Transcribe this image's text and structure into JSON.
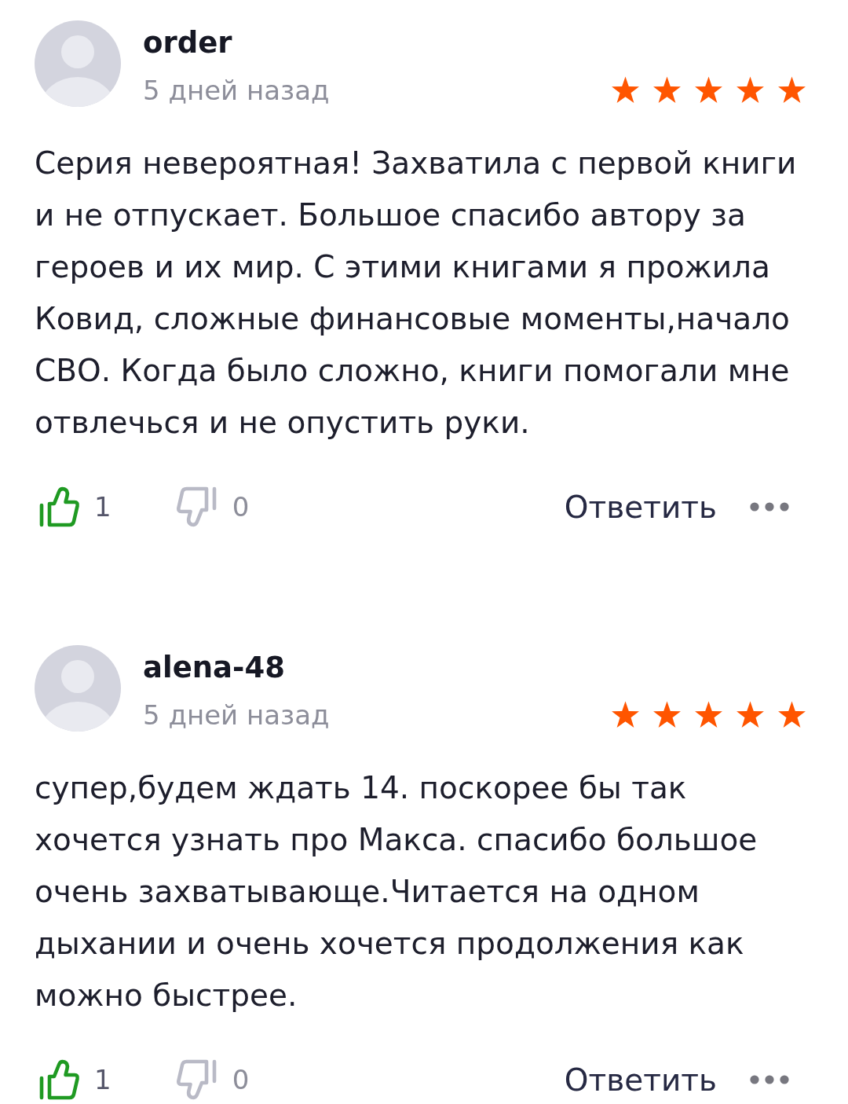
{
  "reviews": [
    {
      "author": "order",
      "date": "5 дней назад",
      "stars": 5,
      "text": "Серия невероятная! Захватила с первой книги и не отпускает. Большое спасибо автору за героев и их мир. С этими книгами я прожила Ковид, сложные финансовые моменты,начало СВО. Когда было сложно, книги помогали мне отвлечься и не опустить руки.",
      "likes": "1",
      "dislikes": "0",
      "reply": "Ответить"
    },
    {
      "author": "alena-48",
      "date": "5 дней назад",
      "stars": 5,
      "text": "супер,будем ждать 14. поскорее бы так хочется узнать про Макса. спасибо большое очень захватывающе.Читается на одном дыхании и очень хочется продолжения как можно быстрее.",
      "likes": "1",
      "dislikes": "0",
      "reply": "Ответить"
    }
  ]
}
